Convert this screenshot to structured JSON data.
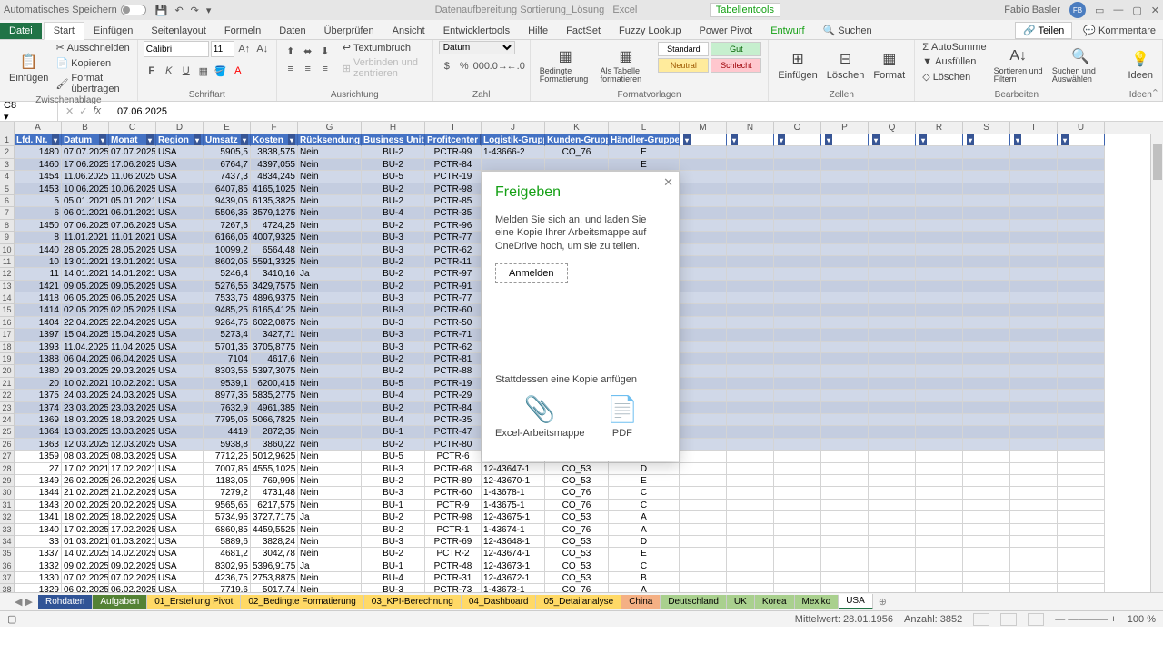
{
  "title": {
    "autosave": "Automatisches Speichern",
    "docname": "Datenaufbereitung Sortierung_Lösung",
    "app": "Excel",
    "tabtools": "Tabellentools",
    "user": "Fabio Basler",
    "initials": "FB"
  },
  "tabs": {
    "file": "Datei",
    "start": "Start",
    "einfugen": "Einfügen",
    "seiten": "Seitenlayout",
    "formeln": "Formeln",
    "daten": "Daten",
    "uber": "Überprüfen",
    "ansicht": "Ansicht",
    "entw": "Entwicklertools",
    "hilfe": "Hilfe",
    "factset": "FactSet",
    "fuzzy": "Fuzzy Lookup",
    "power": "Power Pivot",
    "entwurf": "Entwurf",
    "suchen": "Suchen",
    "teilen": "Teilen",
    "komm": "Kommentare"
  },
  "ribbon": {
    "clip": {
      "label": "Zwischenablage",
      "einfugen": "Einfügen",
      "auss": "Ausschneiden",
      "kop": "Kopieren",
      "format": "Format übertragen"
    },
    "font": {
      "label": "Schriftart",
      "name": "Calibri",
      "size": "11"
    },
    "align": {
      "label": "Ausrichtung",
      "umbruch": "Textumbruch",
      "verb": "Verbinden und zentrieren"
    },
    "num": {
      "label": "Zahl",
      "format": "Datum"
    },
    "styles": {
      "label": "Formatvorlagen",
      "bed": "Bedingte Formatierung",
      "tab": "Als Tabelle formatieren",
      "std": "Standard",
      "gut": "Gut",
      "neu": "Neutral",
      "sch": "Schlecht"
    },
    "cells": {
      "label": "Zellen",
      "ins": "Einfügen",
      "del": "Löschen",
      "fmt": "Format"
    },
    "edit": {
      "label": "Bearbeiten",
      "sum": "AutoSumme",
      "fill": "Ausfüllen",
      "clear": "Löschen",
      "sort": "Sortieren und Filtern",
      "find": "Suchen und Auswählen"
    },
    "ideen": {
      "label": "Ideen",
      "btn": "Ideen"
    }
  },
  "namebox": "C8",
  "formula": "07.06.2025",
  "cols": [
    "A",
    "B",
    "C",
    "D",
    "E",
    "F",
    "G",
    "H",
    "I",
    "J",
    "K",
    "L",
    "M",
    "N",
    "O",
    "P",
    "Q",
    "R",
    "S",
    "T",
    "U"
  ],
  "headers": [
    "Lfd. Nr.",
    "Datum",
    "Monat",
    "Region",
    "Umsatz",
    "Kosten",
    "Rücksendung",
    "Business Unit",
    "Profitcenter",
    "Logistik-Gruppe",
    "Kunden-Gruppe",
    "Händler-Gruppe"
  ],
  "rows": [
    [
      1480,
      "07.07.2025",
      "07.07.2025",
      "USA",
      "5905,5",
      "3838,575",
      "Nein",
      "BU-2",
      "PCTR-99",
      "1-43666-2",
      "CO_76",
      "E"
    ],
    [
      1460,
      "17.06.2025",
      "17.06.2025",
      "USA",
      "6764,7",
      "4397,055",
      "Nein",
      "BU-2",
      "PCTR-84",
      "",
      "",
      "E"
    ],
    [
      1454,
      "11.06.2025",
      "11.06.2025",
      "USA",
      "7437,3",
      "4834,245",
      "Nein",
      "BU-5",
      "PCTR-19",
      "",
      "",
      ""
    ],
    [
      1453,
      "10.06.2025",
      "10.06.2025",
      "USA",
      "6407,85",
      "4165,1025",
      "Nein",
      "BU-2",
      "PCTR-98",
      "",
      "",
      ""
    ],
    [
      5,
      "05.01.2021",
      "05.01.2021",
      "USA",
      "9439,05",
      "6135,3825",
      "Nein",
      "BU-2",
      "PCTR-85",
      "",
      "",
      ""
    ],
    [
      6,
      "06.01.2021",
      "06.01.2021",
      "USA",
      "5506,35",
      "3579,1275",
      "Nein",
      "BU-4",
      "PCTR-35",
      "",
      "",
      ""
    ],
    [
      1450,
      "07.06.2025",
      "07.06.2025",
      "USA",
      "7267,5",
      "4724,25",
      "Nein",
      "BU-2",
      "PCTR-96",
      "",
      "",
      ""
    ],
    [
      8,
      "11.01.2021",
      "11.01.2021",
      "USA",
      "6166,05",
      "4007,9325",
      "Nein",
      "BU-3",
      "PCTR-77",
      "",
      "",
      ""
    ],
    [
      1440,
      "28.05.2025",
      "28.05.2025",
      "USA",
      "10099,2",
      "6564,48",
      "Nein",
      "BU-3",
      "PCTR-62",
      "",
      "",
      ""
    ],
    [
      10,
      "13.01.2021",
      "13.01.2021",
      "USA",
      "8602,05",
      "5591,3325",
      "Nein",
      "BU-2",
      "PCTR-11",
      "",
      "",
      ""
    ],
    [
      11,
      "14.01.2021",
      "14.01.2021",
      "USA",
      "5246,4",
      "3410,16",
      "Ja",
      "BU-2",
      "PCTR-97",
      "",
      "",
      ""
    ],
    [
      1421,
      "09.05.2025",
      "09.05.2025",
      "USA",
      "5276,55",
      "3429,7575",
      "Nein",
      "BU-2",
      "PCTR-91",
      "",
      "",
      ""
    ],
    [
      1418,
      "06.05.2025",
      "06.05.2025",
      "USA",
      "7533,75",
      "4896,9375",
      "Nein",
      "BU-3",
      "PCTR-77",
      "",
      "",
      ""
    ],
    [
      1414,
      "02.05.2025",
      "02.05.2025",
      "USA",
      "9485,25",
      "6165,4125",
      "Nein",
      "BU-3",
      "PCTR-60",
      "",
      "",
      ""
    ],
    [
      1404,
      "22.04.2025",
      "22.04.2025",
      "USA",
      "9264,75",
      "6022,0875",
      "Nein",
      "BU-3",
      "PCTR-50",
      "",
      "",
      ""
    ],
    [
      1397,
      "15.04.2025",
      "15.04.2025",
      "USA",
      "5273,4",
      "3427,71",
      "Nein",
      "BU-3",
      "PCTR-71",
      "",
      "",
      ""
    ],
    [
      1393,
      "11.04.2025",
      "11.04.2025",
      "USA",
      "5701,35",
      "3705,8775",
      "Nein",
      "BU-3",
      "PCTR-62",
      "",
      "",
      ""
    ],
    [
      1388,
      "06.04.2025",
      "06.04.2025",
      "USA",
      "7104",
      "4617,6",
      "Nein",
      "BU-2",
      "PCTR-81",
      "",
      "",
      ""
    ],
    [
      1380,
      "29.03.2025",
      "29.03.2025",
      "USA",
      "8303,55",
      "5397,3075",
      "Nein",
      "BU-2",
      "PCTR-88",
      "",
      "",
      ""
    ],
    [
      20,
      "10.02.2021",
      "10.02.2021",
      "USA",
      "9539,1",
      "6200,415",
      "Nein",
      "BU-5",
      "PCTR-19",
      "",
      "",
      ""
    ],
    [
      1375,
      "24.03.2025",
      "24.03.2025",
      "USA",
      "8977,35",
      "5835,2775",
      "Nein",
      "BU-4",
      "PCTR-29",
      "",
      "",
      ""
    ],
    [
      1374,
      "23.03.2025",
      "23.03.2025",
      "USA",
      "7632,9",
      "4961,385",
      "Nein",
      "BU-2",
      "PCTR-84",
      "",
      "",
      ""
    ],
    [
      1369,
      "18.03.2025",
      "18.03.2025",
      "USA",
      "7795,05",
      "5066,7825",
      "Nein",
      "BU-4",
      "PCTR-35",
      "",
      "",
      ""
    ],
    [
      1364,
      "13.03.2025",
      "13.03.2025",
      "USA",
      "4419",
      "2872,35",
      "Nein",
      "BU-1",
      "PCTR-47",
      "",
      "",
      ""
    ],
    [
      1363,
      "12.03.2025",
      "12.03.2025",
      "USA",
      "5938,8",
      "3860,22",
      "Nein",
      "BU-2",
      "PCTR-80",
      "",
      "",
      ""
    ],
    [
      1359,
      "08.03.2025",
      "08.03.2025",
      "USA",
      "7712,25",
      "5012,9625",
      "Nein",
      "BU-5",
      "PCTR-6",
      "",
      "",
      ""
    ],
    [
      27,
      "17.02.2021",
      "17.02.2021",
      "USA",
      "7007,85",
      "4555,1025",
      "Nein",
      "BU-3",
      "PCTR-68",
      "12-43647-1",
      "CO_53",
      "D"
    ],
    [
      1349,
      "26.02.2025",
      "26.02.2025",
      "USA",
      "1183,05",
      "769,995",
      "Nein",
      "BU-2",
      "PCTR-89",
      "12-43670-1",
      "CO_53",
      "E"
    ],
    [
      1344,
      "21.02.2025",
      "21.02.2025",
      "USA",
      "7279,2",
      "4731,48",
      "Nein",
      "BU-3",
      "PCTR-60",
      "1-43678-1",
      "CO_76",
      "C"
    ],
    [
      1343,
      "20.02.2025",
      "20.02.2025",
      "USA",
      "9565,65",
      "6217,575",
      "Nein",
      "BU-1",
      "PCTR-9",
      "1-43675-1",
      "CO_76",
      "C"
    ],
    [
      1341,
      "18.02.2025",
      "18.02.2025",
      "USA",
      "5734,95",
      "3727,7175",
      "Ja",
      "BU-2",
      "PCTR-98",
      "12-43675-1",
      "CO_53",
      "A"
    ],
    [
      1340,
      "17.02.2025",
      "17.02.2025",
      "USA",
      "6860,85",
      "4459,5525",
      "Nein",
      "BU-2",
      "PCTR-1",
      "1-43674-1",
      "CO_76",
      "A"
    ],
    [
      33,
      "01.03.2021",
      "01.03.2021",
      "USA",
      "5889,6",
      "3828,24",
      "Nein",
      "BU-3",
      "PCTR-69",
      "12-43648-1",
      "CO_53",
      "D"
    ],
    [
      1337,
      "14.02.2025",
      "14.02.2025",
      "USA",
      "4681,2",
      "3042,78",
      "Nein",
      "BU-2",
      "PCTR-2",
      "12-43674-1",
      "CO_53",
      "E"
    ],
    [
      1332,
      "09.02.2025",
      "09.02.2025",
      "USA",
      "8302,95",
      "5396,9175",
      "Ja",
      "BU-1",
      "PCTR-48",
      "12-43673-1",
      "CO_53",
      "C"
    ],
    [
      1330,
      "07.02.2025",
      "07.02.2025",
      "USA",
      "4236,75",
      "2753,8875",
      "Nein",
      "BU-4",
      "PCTR-31",
      "12-43672-1",
      "CO_53",
      "B"
    ],
    [
      1329,
      "06.02.2025",
      "06.02.2025",
      "USA",
      "7719,6",
      "5017,74",
      "Nein",
      "BU-3",
      "PCTR-73",
      "1-43673-1",
      "CO_76",
      "A"
    ]
  ],
  "share": {
    "title": "Freigeben",
    "msg": "Melden Sie sich an, und laden Sie eine Kopie Ihrer Arbeitsmappe auf OneDrive hoch, um sie zu teilen.",
    "login": "Anmelden",
    "alt": "Stattdessen eine Kopie anfügen",
    "excel": "Excel-Arbeitsmappe",
    "pdf": "PDF"
  },
  "sheets": {
    "roh": "Rohdaten",
    "auf": "Aufgaben",
    "s1": "01_Erstellung Pivot",
    "s2": "02_Bedingte Formatierung",
    "s3": "03_KPI-Berechnung",
    "s4": "04_Dashboard",
    "s5": "05_Detailanalyse",
    "china": "China",
    "de": "Deutschland",
    "uk": "UK",
    "korea": "Korea",
    "mex": "Mexiko",
    "usa": "USA"
  },
  "status": {
    "mw": "Mittelwert: 28.01.1956",
    "anz": "Anzahl: 3852",
    "zoom": "100 %"
  }
}
